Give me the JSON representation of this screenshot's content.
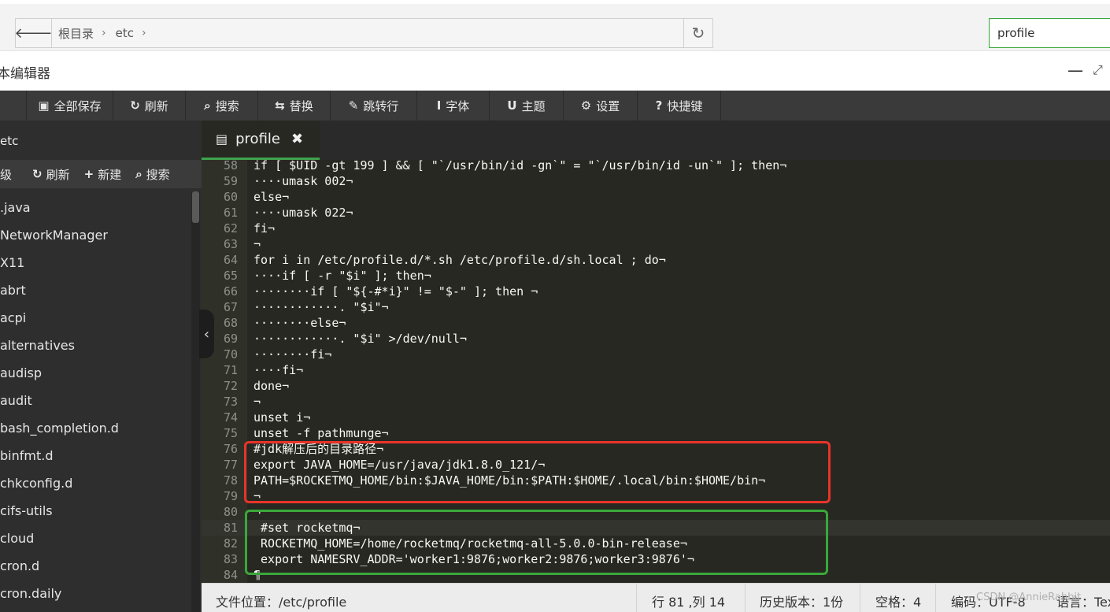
{
  "address_bar": {
    "back_icon": "arrow-left-icon",
    "breadcrumb": [
      "根目录",
      "etc"
    ],
    "separator": "›",
    "refresh_icon": "refresh-icon",
    "search_value": "profile"
  },
  "window": {
    "title": "本编辑器",
    "minimize_glyph": "—",
    "maximize_glyph": "⤢"
  },
  "toolbar": {
    "items": [
      {
        "icon": "save-icon",
        "glyph": "▣",
        "label": "全部保存"
      },
      {
        "icon": "refresh-icon",
        "glyph": "↻",
        "label": "刷新"
      },
      {
        "icon": "search-icon",
        "glyph": "⌕",
        "label": "搜索"
      },
      {
        "icon": "replace-icon",
        "glyph": "⇆",
        "label": "替换"
      },
      {
        "icon": "pin-icon",
        "glyph": "✎",
        "label": "跳转行"
      },
      {
        "icon": "font-icon",
        "glyph": "I",
        "label": "字体"
      },
      {
        "icon": "theme-icon",
        "glyph": "U",
        "label": "主题"
      },
      {
        "icon": "gear-icon",
        "glyph": "⚙",
        "label": "设置"
      },
      {
        "icon": "help-icon",
        "glyph": "?",
        "label": "快捷键"
      }
    ]
  },
  "sidebar": {
    "header": "etc",
    "actions": [
      {
        "icon": "",
        "glyph": "",
        "label": "级"
      },
      {
        "icon": "refresh-icon",
        "glyph": "↻",
        "label": "刷新"
      },
      {
        "icon": "plus-icon",
        "glyph": "+",
        "label": "新建"
      },
      {
        "icon": "search-icon",
        "glyph": "⌕",
        "label": "搜索"
      }
    ],
    "items": [
      ".java",
      "NetworkManager",
      "X11",
      "abrt",
      "acpi",
      "alternatives",
      "audisp",
      "audit",
      "bash_completion.d",
      "binfmt.d",
      "chkconfig.d",
      "cifs-utils",
      "cloud",
      "cron.d",
      "cron.daily"
    ],
    "collapse_glyph": "‹"
  },
  "editor": {
    "tab": {
      "icon": "file-icon",
      "glyph": "▤",
      "label": "profile",
      "close_glyph": "✖"
    },
    "active_line": 81,
    "lines": [
      {
        "n": "58",
        "text": "if [ $UID -gt 199 ] && [ \"`/usr/bin/id -gn`\" = \"`/usr/bin/id -un`\" ]; then¬"
      },
      {
        "n": "59",
        "text": "····umask 002¬"
      },
      {
        "n": "60",
        "text": "else¬"
      },
      {
        "n": "61",
        "text": "····umask 022¬"
      },
      {
        "n": "62",
        "text": "fi¬"
      },
      {
        "n": "63",
        "text": "¬"
      },
      {
        "n": "64",
        "text": "for i in /etc/profile.d/*.sh /etc/profile.d/sh.local ; do¬"
      },
      {
        "n": "65",
        "text": "····if [ -r \"$i\" ]; then¬"
      },
      {
        "n": "66",
        "text": "········if [ \"${-#*i}\" != \"$-\" ]; then ¬"
      },
      {
        "n": "67",
        "text": "············. \"$i\"¬"
      },
      {
        "n": "68",
        "text": "········else¬"
      },
      {
        "n": "69",
        "text": "············. \"$i\" >/dev/null¬"
      },
      {
        "n": "70",
        "text": "········fi¬"
      },
      {
        "n": "71",
        "text": "····fi¬"
      },
      {
        "n": "72",
        "text": "done¬"
      },
      {
        "n": "73",
        "text": "¬"
      },
      {
        "n": "74",
        "text": "unset i¬"
      },
      {
        "n": "75",
        "text": "unset -f pathmunge¬"
      },
      {
        "n": "76",
        "text": "#jdk解压后的目录路径¬"
      },
      {
        "n": "77",
        "text": "export JAVA_HOME=/usr/java/jdk1.8.0_121/¬"
      },
      {
        "n": "78",
        "text": "PATH=$ROCKETMQ_HOME/bin:$JAVA_HOME/bin:$PATH:$HOME/.local/bin:$HOME/bin¬"
      },
      {
        "n": "79",
        "text": "¬"
      },
      {
        "n": "80",
        "text": "¬"
      },
      {
        "n": "81",
        "text": " #set rocketmq¬"
      },
      {
        "n": "82",
        "text": " ROCKETMQ_HOME=/home/rocketmq/rocketmq-all-5.0.0-bin-release¬"
      },
      {
        "n": "83",
        "text": " export NAMESRV_ADDR='worker1:9876;worker2:9876;worker3:9876'¬"
      },
      {
        "n": "84",
        "text": "¶"
      }
    ]
  },
  "status": {
    "location_label": "文件位置：/etc/profile",
    "cursor": "行 81 ,列 14",
    "history": "历史版本：1份",
    "indent": "空格：4",
    "encoding": "编码：UTF-8",
    "language": "语言：Tex"
  },
  "watermark": "CSDN @AnnieRabbit"
}
